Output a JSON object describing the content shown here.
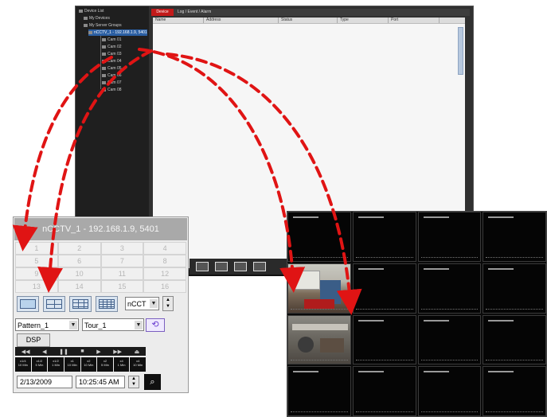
{
  "app": {
    "tree": {
      "items": [
        {
          "label": "Device List",
          "selected": false
        },
        {
          "label": "My Devices",
          "selected": false
        },
        {
          "label": "My Server Groups",
          "selected": false
        },
        {
          "label": "nCCTV_1 - 192.168.1.9, 5401",
          "selected": true
        },
        {
          "label": "Cam 01",
          "selected": false
        },
        {
          "label": "Cam 02",
          "selected": false
        },
        {
          "label": "Cam 03",
          "selected": false
        },
        {
          "label": "Cam 04",
          "selected": false
        },
        {
          "label": "Cam 05",
          "selected": false
        },
        {
          "label": "Cam 06",
          "selected": false
        },
        {
          "label": "Cam 07",
          "selected": false
        },
        {
          "label": "Cam 08",
          "selected": false
        }
      ]
    },
    "tabs": {
      "active": "Device",
      "inactive": "Log / Event / Alarm"
    },
    "list_columns": [
      "Name",
      "Address",
      "Status",
      "Type",
      "Port"
    ]
  },
  "control_panel": {
    "device_title": "nCCTV_1 - 192.168.1.9, 5401",
    "channels": [
      "1",
      "2",
      "3",
      "4",
      "5",
      "6",
      "7",
      "8",
      "9",
      "10",
      "11",
      "12",
      "13",
      "14",
      "15",
      "16"
    ],
    "split_buttons": [
      "single-view",
      "quad-view",
      "nine-view",
      "sixteen-view"
    ],
    "ncct_select": "nCCT",
    "pattern_select": "Pattern_1",
    "tour_select": "Tour_1",
    "dsp_label": "DSP",
    "playback": [
      "◀◀",
      "◀",
      "❚❚",
      "■",
      "▶",
      "▶▶",
      "⏏"
    ],
    "speeds": [
      "x1/4\n10 Min",
      "x1/2\n5 Min",
      "x1/2\n1 Min",
      "x1\n10 Min",
      "x2\n10 Min",
      "x2\n5 Min",
      "x4\n1 Min",
      "x4\n10 Min"
    ],
    "date": "2/13/2009",
    "time": "10:25:45 AM",
    "search_icon": "magnifier-icon"
  },
  "video_wall": {
    "tiles": [
      "empty",
      "empty",
      "empty",
      "empty",
      "cam1",
      "empty",
      "empty",
      "empty",
      "cam2",
      "empty",
      "empty",
      "empty",
      "empty",
      "empty",
      "empty",
      "empty"
    ]
  },
  "colors": {
    "arrow": "#e01414",
    "title_bar": "#a9a9a9",
    "selected_tree": "#2b5fa3",
    "tab_active": "#c21a1a"
  }
}
